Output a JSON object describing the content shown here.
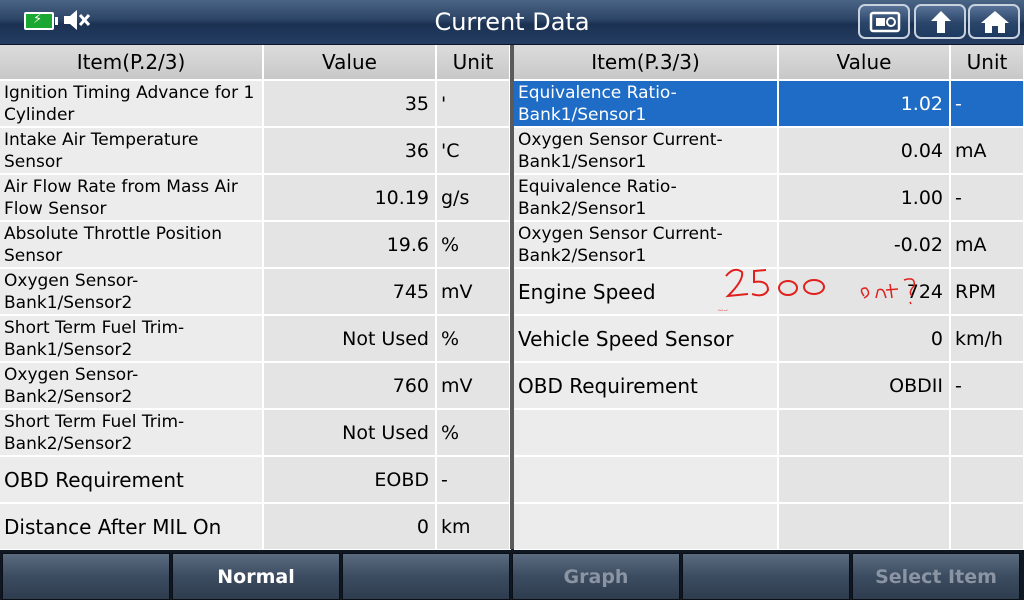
{
  "title": "Current Data",
  "status_icons": [
    "battery-charging-icon",
    "speaker-muted-icon"
  ],
  "toolbar_icons": [
    "screenshot-icon",
    "back-arrow-icon",
    "home-icon"
  ],
  "left_table": {
    "headers": {
      "item": "Item(P.2/3)",
      "value": "Value",
      "unit": "Unit"
    },
    "rows": [
      {
        "item": "Ignition Timing Advance for 1 Cylinder",
        "value": "35",
        "unit": "'"
      },
      {
        "item": "Intake Air Temperature Sensor",
        "value": "36",
        "unit": "'C"
      },
      {
        "item": "Air Flow Rate from Mass Air Flow Sensor",
        "value": "10.19",
        "unit": "g/s"
      },
      {
        "item": "Absolute Throttle Position Sensor",
        "value": "19.6",
        "unit": "%"
      },
      {
        "item": "Oxygen Sensor-Bank1/Sensor2",
        "value": "745",
        "unit": "mV"
      },
      {
        "item": "Short Term Fuel Trim-Bank1/Sensor2",
        "value": "Not Used",
        "unit": "%"
      },
      {
        "item": "Oxygen Sensor-Bank2/Sensor2",
        "value": "760",
        "unit": "mV"
      },
      {
        "item": "Short Term Fuel Trim-Bank2/Sensor2",
        "value": "Not Used",
        "unit": "%"
      },
      {
        "item": "OBD Requirement",
        "value": "EOBD",
        "unit": "-"
      },
      {
        "item": "Distance After MIL On",
        "value": "0",
        "unit": "km"
      }
    ]
  },
  "right_table": {
    "headers": {
      "item": "Item(P.3/3)",
      "value": "Value",
      "unit": "Unit"
    },
    "rows": [
      {
        "item": "Equivalence Ratio-Bank1/Sensor1",
        "value": "1.02",
        "unit": "-"
      },
      {
        "item": "Oxygen Sensor Current-Bank1/Sensor1",
        "value": "0.04",
        "unit": "mA"
      },
      {
        "item": "Equivalence Ratio-Bank2/Sensor1",
        "value": "1.00",
        "unit": "-"
      },
      {
        "item": "Oxygen Sensor Current-Bank2/Sensor1",
        "value": "-0.02",
        "unit": "mA"
      },
      {
        "item": "Engine Speed",
        "value": "724",
        "unit": "RPM"
      },
      {
        "item": "Vehicle Speed Sensor",
        "value": "0",
        "unit": "km/h"
      },
      {
        "item": "OBD Requirement",
        "value": "OBDII",
        "unit": "-"
      },
      {
        "item": "",
        "value": "",
        "unit": ""
      },
      {
        "item": "",
        "value": "",
        "unit": ""
      },
      {
        "item": "",
        "value": "",
        "unit": ""
      }
    ],
    "selected_row": 0
  },
  "annotation": {
    "text": "2500 ont?",
    "color": "#e0201c"
  },
  "bottom_buttons": [
    {
      "label": "",
      "enabled": true
    },
    {
      "label": "Normal",
      "enabled": true
    },
    {
      "label": "",
      "enabled": true
    },
    {
      "label": "Graph",
      "enabled": false
    },
    {
      "label": "",
      "enabled": true
    },
    {
      "label": "Select Item",
      "enabled": false
    }
  ]
}
